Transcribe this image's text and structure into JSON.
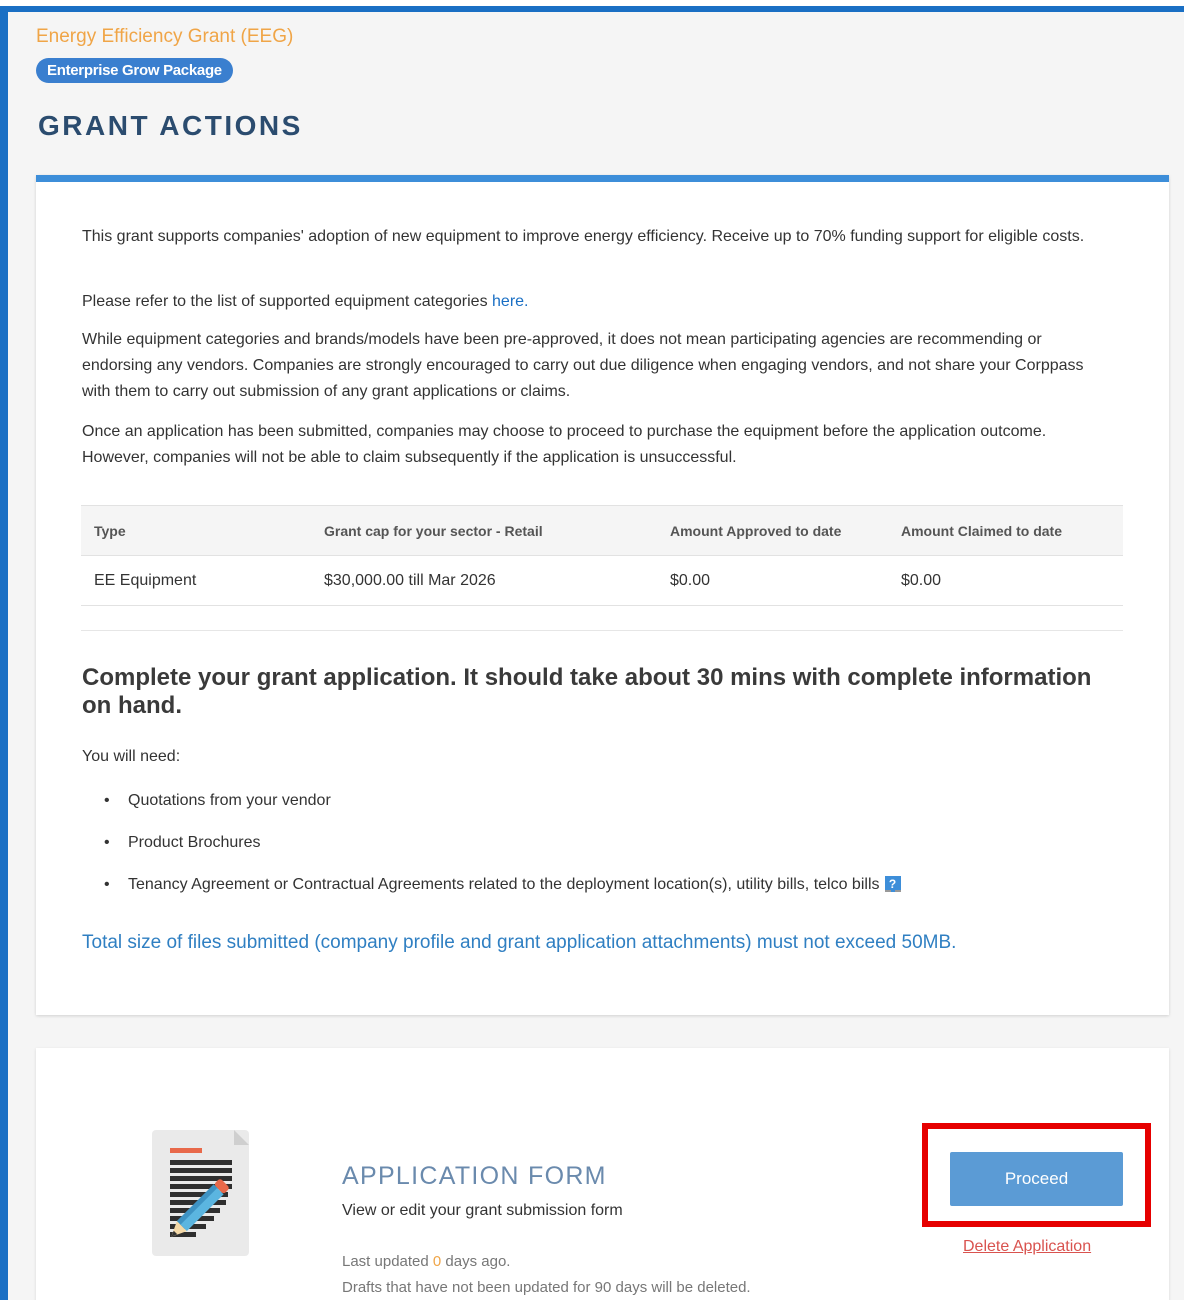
{
  "header": {
    "grant_name": "Energy Efficiency Grant (EEG)",
    "package": "Enterprise Grow Package",
    "title": "GRANT ACTIONS"
  },
  "info": {
    "para1": "This grant supports companies' adoption of new equipment to improve energy efficiency. Receive up to 70% funding support for eligible costs.",
    "para2_prefix": "Please refer to the list of supported equipment categories ",
    "para2_link": "here.",
    "para3": "While equipment categories and brands/models have been pre-approved, it does not mean participating agencies are recommending or endorsing any vendors. Companies are strongly encouraged to carry out due diligence when engaging vendors, and not share your Corppass with them to carry out submission of any grant applications or claims.",
    "para4": "Once an application has been submitted, companies may choose to proceed to purchase the equipment before the application outcome. However, companies will not be able to claim subsequently if the application is unsuccessful."
  },
  "table": {
    "headers": [
      "Type",
      "Grant cap for your sector - Retail",
      "Amount Approved to date",
      "Amount Claimed to date"
    ],
    "rows": [
      [
        "EE Equipment",
        "$30,000.00 till Mar 2026",
        "$0.00",
        "$0.00"
      ]
    ]
  },
  "instructions": {
    "title": "Complete your grant application. It should take about 30 mins with complete information on hand.",
    "need_label": "You will need:",
    "items": [
      "Quotations from your vendor",
      "Product Brochures",
      "Tenancy Agreement or Contractual Agreements related to the deployment location(s), utility bills, telco bills"
    ],
    "help_icon": "?",
    "size_note": "Total size of files submitted (company profile and grant application attachments) must not exceed 50MB."
  },
  "application_form": {
    "title": "APPLICATION FORM",
    "subtitle": "View or edit your grant submission form",
    "last_updated_prefix": "Last updated ",
    "days": "0",
    "last_updated_suffix": " days ago.",
    "drafts_note": "Drafts that have not been updated for 90 days will be deleted.",
    "proceed_label": "Proceed",
    "delete_label": "Delete Application",
    "icon": "document-pencil-icon"
  },
  "colors": {
    "accent_blue": "#1a6fc4",
    "orange": "#f0a547",
    "highlight_red": "#e60000",
    "delete_red": "#d9534f"
  }
}
